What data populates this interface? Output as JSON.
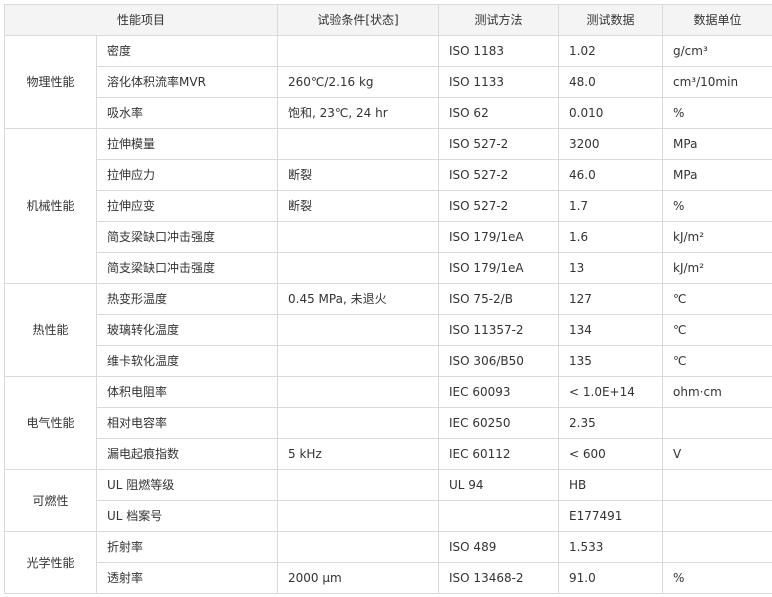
{
  "headers": {
    "property_item": "性能项目",
    "test_condition": "试验条件[状态]",
    "test_method": "测试方法",
    "test_data": "测试数据",
    "data_unit": "数据单位"
  },
  "groups": [
    {
      "category": "物理性能",
      "rows": [
        {
          "property": "密度",
          "condition": "",
          "method": "ISO 1183",
          "value": "1.02",
          "unit": "g/cm³"
        },
        {
          "property": "溶化体积流率MVR",
          "condition": "260℃/2.16 kg",
          "method": "ISO 1133",
          "value": "48.0",
          "unit": "cm³/10min"
        },
        {
          "property": "吸水率",
          "condition": " 饱和, 23℃, 24 hr",
          "method": "ISO 62",
          "value": "0.010",
          "unit": "%"
        }
      ]
    },
    {
      "category": "机械性能",
      "rows": [
        {
          "property": "拉伸模量",
          "condition": "",
          "method": "ISO 527-2",
          "value": "3200",
          "unit": "MPa"
        },
        {
          "property": "拉伸应力",
          "condition": "断裂",
          "method": "ISO 527-2",
          "value": "46.0",
          "unit": "MPa"
        },
        {
          "property": "拉伸应变",
          "condition": "断裂",
          "method": "ISO 527-2",
          "value": "1.7",
          "unit": "%"
        },
        {
          "property": "简支梁缺口冲击强度",
          "condition": "",
          "method": "ISO 179/1eA",
          "value": "1.6",
          "unit": "kJ/m²"
        },
        {
          "property": "简支梁缺口冲击强度",
          "condition": "",
          "method": "ISO 179/1eA",
          "value": "13",
          "unit": "kJ/m²"
        }
      ]
    },
    {
      "category": "热性能",
      "rows": [
        {
          "property": "热变形温度",
          "condition": " 0.45 MPa, 未退火",
          "method": "ISO 75-2/B",
          "value": "127",
          "unit": "℃"
        },
        {
          "property": "玻璃转化温度",
          "condition": "",
          "method": "ISO 11357-2",
          "value": "134",
          "unit": "℃"
        },
        {
          "property": "维卡软化温度",
          "condition": "",
          "method": "ISO 306/B50",
          "value": "135",
          "unit": "℃"
        }
      ]
    },
    {
      "category": "电气性能",
      "rows": [
        {
          "property": "体积电阻率",
          "condition": "",
          "method": "IEC 60093",
          "value": "< 1.0E+14",
          "unit": "ohm·cm"
        },
        {
          "property": "相对电容率",
          "condition": "",
          "method": "IEC 60250",
          "value": "2.35",
          "unit": ""
        },
        {
          "property": "漏电起痕指数",
          "condition": "5 kHz",
          "method": "IEC 60112",
          "value": "< 600",
          "unit": "V"
        }
      ]
    },
    {
      "category": "可燃性",
      "rows": [
        {
          "property": "UL 阻燃等级",
          "condition": "",
          "method": "UL 94",
          "value": "HB",
          "unit": ""
        },
        {
          "property": "UL 档案号",
          "condition": "",
          "method": "",
          "value": "E177491",
          "unit": ""
        }
      ]
    },
    {
      "category": "光学性能",
      "rows": [
        {
          "property": "折射率",
          "condition": "",
          "method": "ISO 489",
          "value": "1.533",
          "unit": ""
        },
        {
          "property": "透射率",
          "condition": " 2000 μm",
          "method": "ISO 13468-2",
          "value": "91.0",
          "unit": "%"
        }
      ]
    }
  ]
}
